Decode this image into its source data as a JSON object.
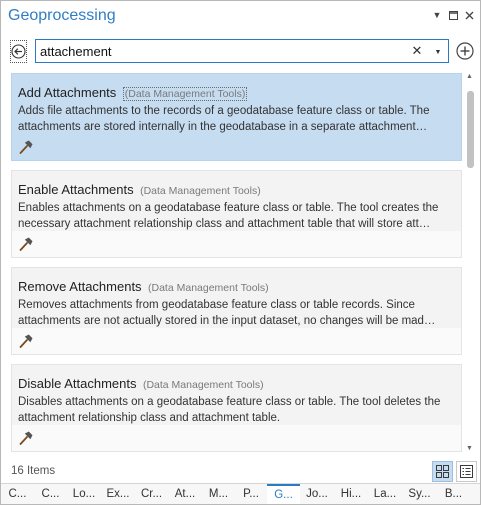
{
  "window": {
    "title": "Geoprocessing",
    "controls": [
      "dropdown-icon",
      "restore-icon",
      "close-icon"
    ]
  },
  "search": {
    "value": "attachement",
    "back_icon": "back-arrow-icon",
    "clear_icon": "clear-icon",
    "dropdown_icon": "chevron-down-icon",
    "add_icon": "add-icon"
  },
  "results": [
    {
      "title": "Add Attachments",
      "category": "(Data Management Tools)",
      "description": "Adds file attachments to the records of a geodatabase feature class or table. The attachments are stored internally in the geodatabase in a separate attachment…",
      "icon": "hammer-icon",
      "selected": true
    },
    {
      "title": "Enable Attachments",
      "category": "(Data Management Tools)",
      "description": "Enables attachments on a geodatabase feature class or table. The tool creates the necessary attachment relationship class and attachment table that will store att…",
      "icon": "hammer-icon",
      "selected": false
    },
    {
      "title": "Remove Attachments",
      "category": "(Data Management Tools)",
      "description": "Removes attachments from geodatabase feature class or table records. Since attachments are not actually stored in the input dataset, no changes will be mad…",
      "icon": "hammer-icon",
      "selected": false
    },
    {
      "title": "Disable Attachments",
      "category": "(Data Management Tools)",
      "description": "Disables attachments on a geodatabase feature class or table. The tool deletes the attachment relationship class and attachment table.",
      "icon": "hammer-icon",
      "selected": false
    }
  ],
  "status": {
    "count": "16 Items",
    "view_icons": [
      "tile-view-icon",
      "list-view-icon"
    ],
    "active_view": "tile-view"
  },
  "bottom_tabs": [
    {
      "label": "C..."
    },
    {
      "label": "C..."
    },
    {
      "label": "Lo..."
    },
    {
      "label": "Ex..."
    },
    {
      "label": "Cr..."
    },
    {
      "label": "At..."
    },
    {
      "label": "M..."
    },
    {
      "label": "P..."
    },
    {
      "label": "G...",
      "active": true
    },
    {
      "label": "Jo..."
    },
    {
      "label": "Hi..."
    },
    {
      "label": "La..."
    },
    {
      "label": "Sy..."
    },
    {
      "label": "B..."
    }
  ],
  "colors": {
    "accent": "#2b7bc4",
    "title": "#2f7ec4",
    "selected_bg": "#c6dcf1",
    "card_bg": "#f3f3f3"
  }
}
